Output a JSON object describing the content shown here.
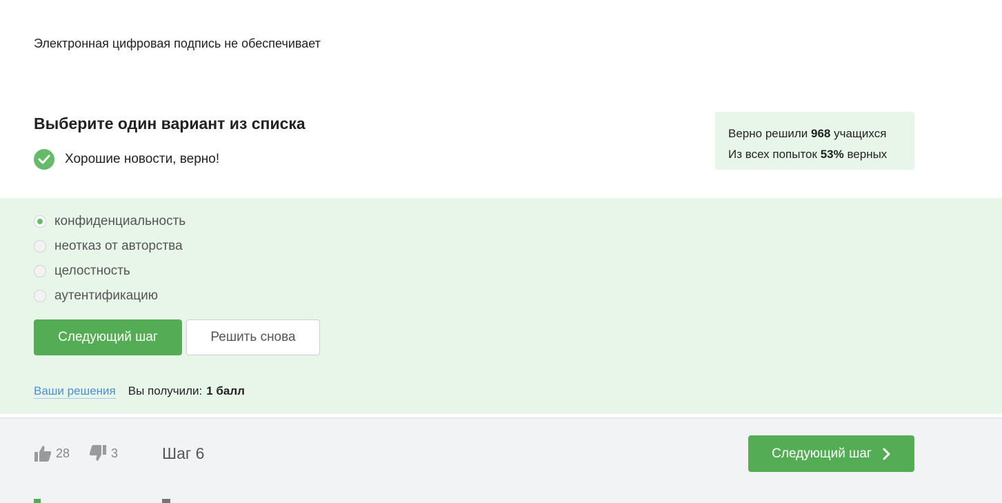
{
  "question": {
    "text": "Электронная цифровая подпись не обеспечивает"
  },
  "task": {
    "title": "Выберите один вариант из списка",
    "verdict": "Хорошие новости, верно!"
  },
  "stats": {
    "line1_prefix": "Верно решили ",
    "solved_count": "968",
    "line1_suffix": " учащихся",
    "line2_prefix": "Из всех попыток ",
    "percent": "53%",
    "line2_suffix": " верных"
  },
  "options": [
    {
      "label": "конфиденциальность",
      "selected": true
    },
    {
      "label": "неотказ от авторства",
      "selected": false
    },
    {
      "label": "целостность",
      "selected": false
    },
    {
      "label": "аутентификацию",
      "selected": false
    }
  ],
  "buttons": {
    "next": "Следующий шаг",
    "retry": "Решить снова"
  },
  "result": {
    "link": "Ваши решения",
    "text": "Вы получили:",
    "score": "1 балл"
  },
  "footer": {
    "likes": "28",
    "dislikes": "3",
    "step": "Шаг 6",
    "next": "Следующий шаг"
  },
  "colors": {
    "accent": "#54ad54",
    "success_bg": "#e8f6ea",
    "link": "#4a8ed6"
  },
  "icons": {
    "check": "check-circle-icon",
    "like": "thumbs-up-icon",
    "dislike": "thumbs-down-icon",
    "arrow": "chevron-right-icon"
  }
}
